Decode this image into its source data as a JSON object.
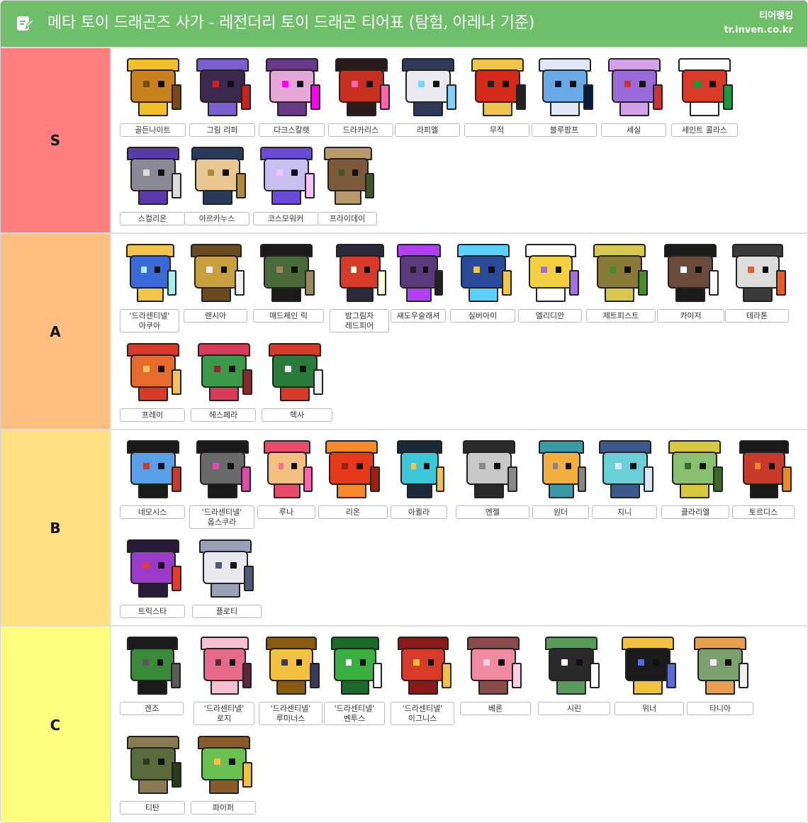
{
  "header": {
    "title": "메타 토이 드래곤즈 사가 - 레전더리 토이 드래곤 티어표 (탐험, 아레나 기준)",
    "brand_line1": "티어랭킹",
    "brand_line2": "tr.inven.co.kr",
    "icon": "edit-note-icon"
  },
  "colors": {
    "header_bg": "#6fbf6a",
    "S": "#ff7f7f",
    "A": "#ffbf7f",
    "B": "#ffdf7f",
    "C": "#ffff7f"
  },
  "tiers": [
    {
      "label": "S",
      "color": "#ff7f7f",
      "items": [
        {
          "name": "골든나이트"
        },
        {
          "name": "그림 리퍼"
        },
        {
          "name": "다크스칼렛"
        },
        {
          "name": "드라카리스"
        },
        {
          "name": "라피엘"
        },
        {
          "name": "무적"
        },
        {
          "name": "블루팜프"
        },
        {
          "name": "세실"
        },
        {
          "name": "세인트 콜라스"
        },
        {
          "name": "스컬리온"
        },
        {
          "name": "아르카누스"
        },
        {
          "name": "코스모워커"
        },
        {
          "name": "프라이데이"
        }
      ]
    },
    {
      "label": "A",
      "color": "#ffbf7f",
      "items": [
        {
          "name": "'드라센티넬'",
          "name2": "아쿠아"
        },
        {
          "name": "랜시아"
        },
        {
          "name": "매드체인 릭"
        },
        {
          "name": "밤그림자",
          "name2": "레드피어"
        },
        {
          "name": "섀도우슬래셔"
        },
        {
          "name": "실버아이"
        },
        {
          "name": "엘리디안"
        },
        {
          "name": "제트피스트"
        },
        {
          "name": "카이저"
        },
        {
          "name": "테라톤"
        },
        {
          "name": "프레이"
        },
        {
          "name": "헤스페라"
        },
        {
          "name": "헥사"
        }
      ]
    },
    {
      "label": "B",
      "color": "#ffdf7f",
      "items": [
        {
          "name": "네모시스"
        },
        {
          "name": "'드라센티넬'",
          "name2": "옵스쿠라"
        },
        {
          "name": "루나"
        },
        {
          "name": "리온"
        },
        {
          "name": "아퀼라"
        },
        {
          "name": "엔젤"
        },
        {
          "name": "원더"
        },
        {
          "name": "지니"
        },
        {
          "name": "클라리엘"
        },
        {
          "name": "토르디스"
        },
        {
          "name": "트릭스타"
        },
        {
          "name": "플로티"
        }
      ]
    },
    {
      "label": "C",
      "color": "#ffff7f",
      "items": [
        {
          "name": "겐조"
        },
        {
          "name": "'드라센티넬'",
          "name2": "로지"
        },
        {
          "name": "'드라센티넬'",
          "name2": "루미너스"
        },
        {
          "name": "'드라센티넬'",
          "name2": "벤투스"
        },
        {
          "name": "'드라센티넬'",
          "name2": "이그니스"
        },
        {
          "name": "베론"
        },
        {
          "name": "시린"
        },
        {
          "name": "위너"
        },
        {
          "name": "타니아"
        },
        {
          "name": "티탄"
        },
        {
          "name": "파이퍼"
        }
      ]
    }
  ]
}
